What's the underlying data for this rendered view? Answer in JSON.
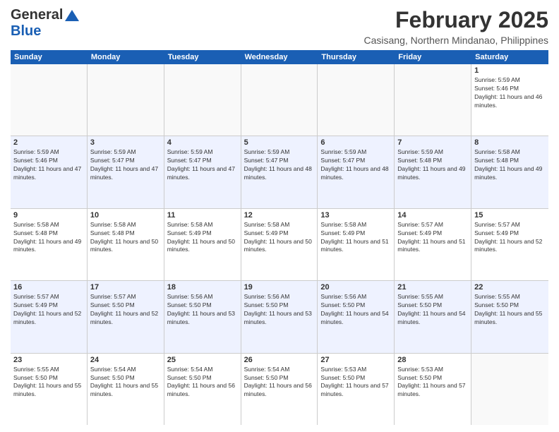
{
  "logo": {
    "general": "General",
    "blue": "Blue"
  },
  "title": "February 2025",
  "location": "Casisang, Northern Mindanao, Philippines",
  "weekdays": [
    "Sunday",
    "Monday",
    "Tuesday",
    "Wednesday",
    "Thursday",
    "Friday",
    "Saturday"
  ],
  "weeks": [
    [
      {
        "day": "",
        "empty": true
      },
      {
        "day": "",
        "empty": true
      },
      {
        "day": "",
        "empty": true
      },
      {
        "day": "",
        "empty": true
      },
      {
        "day": "",
        "empty": true
      },
      {
        "day": "",
        "empty": true
      },
      {
        "day": "1",
        "sunrise": "5:59 AM",
        "sunset": "5:46 PM",
        "daylight": "11 hours and 46 minutes."
      }
    ],
    [
      {
        "day": "2",
        "sunrise": "5:59 AM",
        "sunset": "5:46 PM",
        "daylight": "11 hours and 47 minutes."
      },
      {
        "day": "3",
        "sunrise": "5:59 AM",
        "sunset": "5:47 PM",
        "daylight": "11 hours and 47 minutes."
      },
      {
        "day": "4",
        "sunrise": "5:59 AM",
        "sunset": "5:47 PM",
        "daylight": "11 hours and 47 minutes."
      },
      {
        "day": "5",
        "sunrise": "5:59 AM",
        "sunset": "5:47 PM",
        "daylight": "11 hours and 48 minutes."
      },
      {
        "day": "6",
        "sunrise": "5:59 AM",
        "sunset": "5:47 PM",
        "daylight": "11 hours and 48 minutes."
      },
      {
        "day": "7",
        "sunrise": "5:59 AM",
        "sunset": "5:48 PM",
        "daylight": "11 hours and 49 minutes."
      },
      {
        "day": "8",
        "sunrise": "5:58 AM",
        "sunset": "5:48 PM",
        "daylight": "11 hours and 49 minutes."
      }
    ],
    [
      {
        "day": "9",
        "sunrise": "5:58 AM",
        "sunset": "5:48 PM",
        "daylight": "11 hours and 49 minutes."
      },
      {
        "day": "10",
        "sunrise": "5:58 AM",
        "sunset": "5:48 PM",
        "daylight": "11 hours and 50 minutes."
      },
      {
        "day": "11",
        "sunrise": "5:58 AM",
        "sunset": "5:49 PM",
        "daylight": "11 hours and 50 minutes."
      },
      {
        "day": "12",
        "sunrise": "5:58 AM",
        "sunset": "5:49 PM",
        "daylight": "11 hours and 50 minutes."
      },
      {
        "day": "13",
        "sunrise": "5:58 AM",
        "sunset": "5:49 PM",
        "daylight": "11 hours and 51 minutes."
      },
      {
        "day": "14",
        "sunrise": "5:57 AM",
        "sunset": "5:49 PM",
        "daylight": "11 hours and 51 minutes."
      },
      {
        "day": "15",
        "sunrise": "5:57 AM",
        "sunset": "5:49 PM",
        "daylight": "11 hours and 52 minutes."
      }
    ],
    [
      {
        "day": "16",
        "sunrise": "5:57 AM",
        "sunset": "5:49 PM",
        "daylight": "11 hours and 52 minutes."
      },
      {
        "day": "17",
        "sunrise": "5:57 AM",
        "sunset": "5:50 PM",
        "daylight": "11 hours and 52 minutes."
      },
      {
        "day": "18",
        "sunrise": "5:56 AM",
        "sunset": "5:50 PM",
        "daylight": "11 hours and 53 minutes."
      },
      {
        "day": "19",
        "sunrise": "5:56 AM",
        "sunset": "5:50 PM",
        "daylight": "11 hours and 53 minutes."
      },
      {
        "day": "20",
        "sunrise": "5:56 AM",
        "sunset": "5:50 PM",
        "daylight": "11 hours and 54 minutes."
      },
      {
        "day": "21",
        "sunrise": "5:55 AM",
        "sunset": "5:50 PM",
        "daylight": "11 hours and 54 minutes."
      },
      {
        "day": "22",
        "sunrise": "5:55 AM",
        "sunset": "5:50 PM",
        "daylight": "11 hours and 55 minutes."
      }
    ],
    [
      {
        "day": "23",
        "sunrise": "5:55 AM",
        "sunset": "5:50 PM",
        "daylight": "11 hours and 55 minutes."
      },
      {
        "day": "24",
        "sunrise": "5:54 AM",
        "sunset": "5:50 PM",
        "daylight": "11 hours and 55 minutes."
      },
      {
        "day": "25",
        "sunrise": "5:54 AM",
        "sunset": "5:50 PM",
        "daylight": "11 hours and 56 minutes."
      },
      {
        "day": "26",
        "sunrise": "5:54 AM",
        "sunset": "5:50 PM",
        "daylight": "11 hours and 56 minutes."
      },
      {
        "day": "27",
        "sunrise": "5:53 AM",
        "sunset": "5:50 PM",
        "daylight": "11 hours and 57 minutes."
      },
      {
        "day": "28",
        "sunrise": "5:53 AM",
        "sunset": "5:50 PM",
        "daylight": "11 hours and 57 minutes."
      },
      {
        "day": "",
        "empty": true
      }
    ]
  ]
}
